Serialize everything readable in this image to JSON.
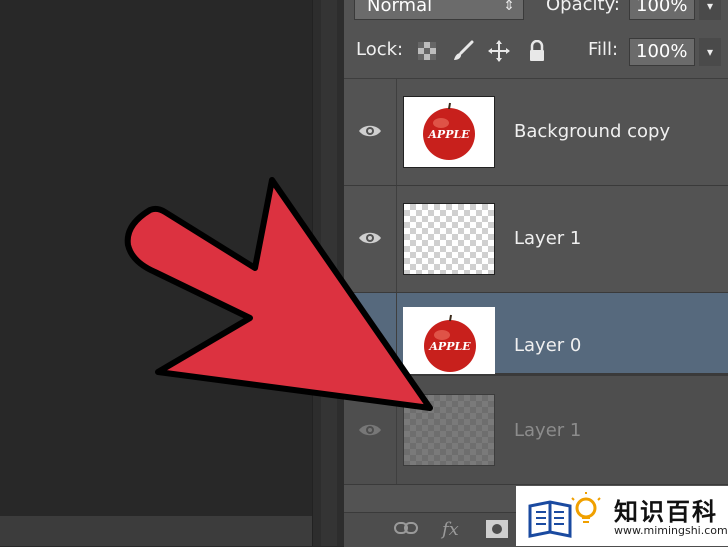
{
  "panel": {
    "blend_mode": "Normal",
    "opacity_label": "Opacity:",
    "opacity_value": "100%",
    "lock_label": "Lock:",
    "fill_label": "Fill:",
    "fill_value": "100%"
  },
  "layers": [
    {
      "name": "Background copy",
      "thumb_text": "APPLE"
    },
    {
      "name": "Layer 1"
    },
    {
      "name": "Layer 0",
      "thumb_text": "APPLE",
      "selected": true
    },
    {
      "name": "Layer 1",
      "dragging_ghost": true
    }
  ],
  "icons": {
    "eye": "eye-icon",
    "lock_transparent": "checkerboard-lock-icon",
    "lock_pixels": "brush-icon",
    "lock_position": "move-icon",
    "lock_all": "padlock-icon",
    "link": "link-icon",
    "fx": "fx-icon",
    "mask": "mask-icon"
  },
  "bottom_bar": {
    "fx_label": "fx"
  },
  "watermark": {
    "title": "知识百科",
    "url": "www.mimingshi.com"
  },
  "colors": {
    "arrow": "#dc3240",
    "selected_row": "#56697d"
  }
}
